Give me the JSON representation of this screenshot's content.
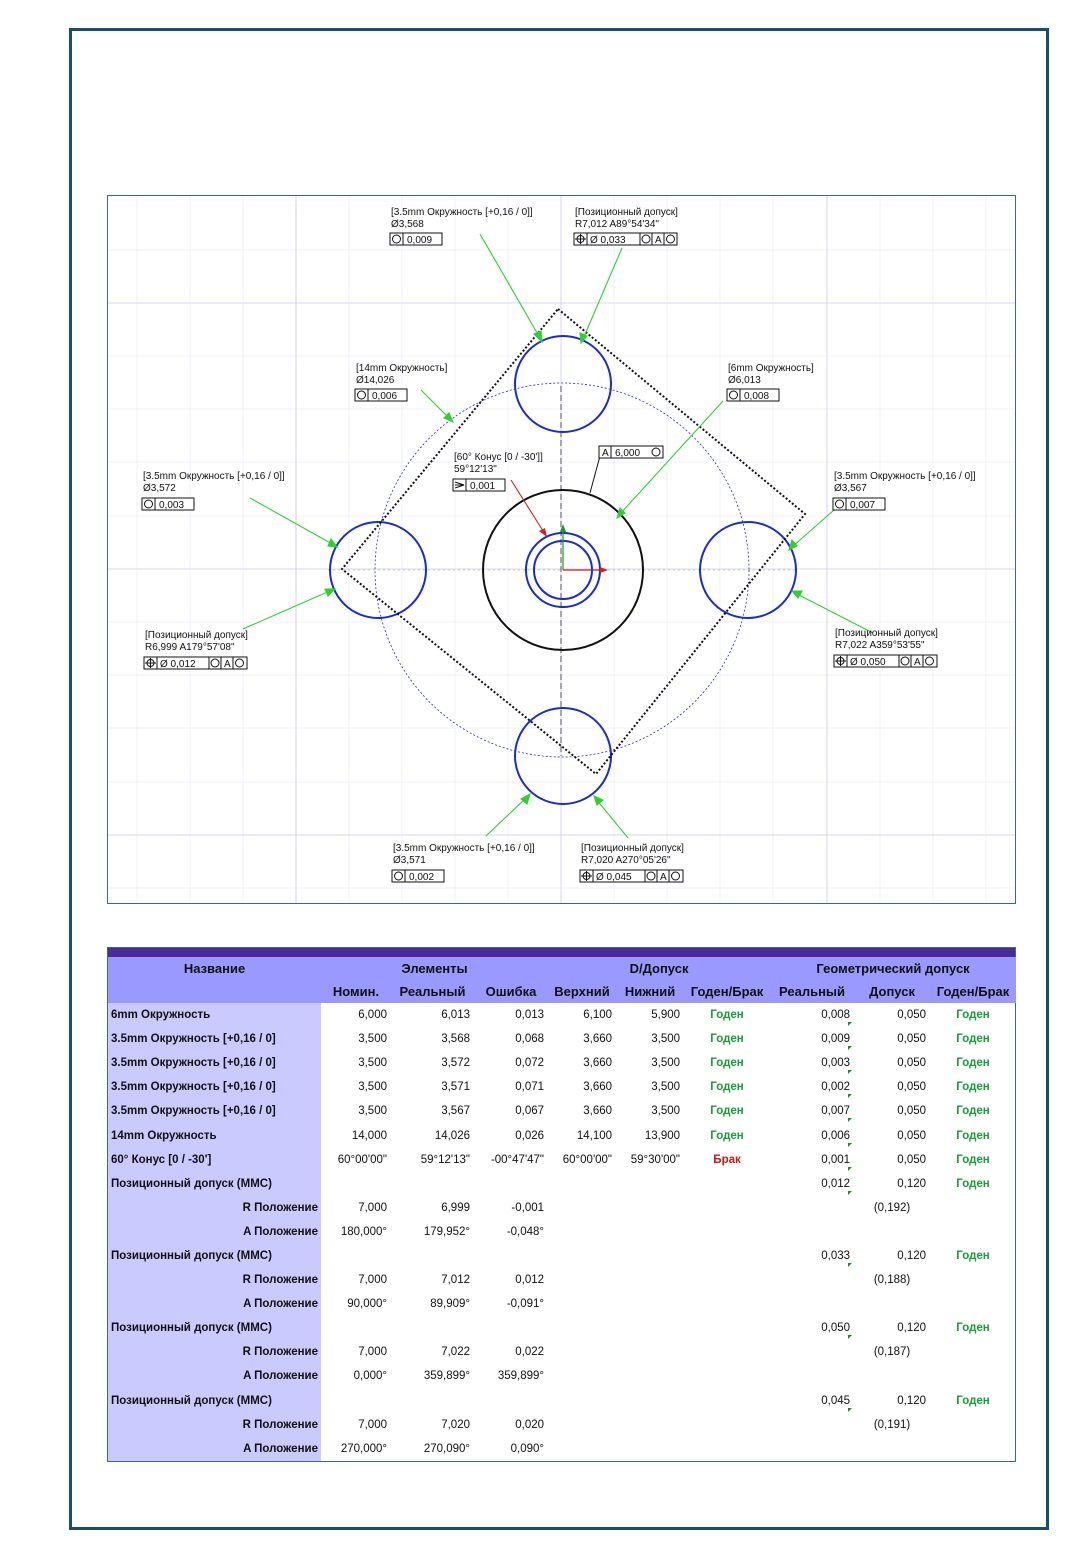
{
  "annotations": {
    "top_circle": {
      "title": "[3.5mm Окружность [+0,16 / 0]]",
      "value": "Ø3,568",
      "tol": "0,009"
    },
    "top_pos": {
      "title": "[Позиционный допуск]",
      "value": "R7,012 A89°54'34\"",
      "tol": "Ø 0,033",
      "ref": "A"
    },
    "c14": {
      "title": "[14mm Окружность]",
      "value": "Ø14,026",
      "tol": "0,006"
    },
    "c6": {
      "title": "[6mm Окружность]",
      "value": "Ø6,013",
      "tol": "0,008"
    },
    "cone": {
      "title": "[60° Конус [0 / -30']]",
      "value": "59°12'13\"",
      "tol": "0,001"
    },
    "datum": {
      "label": "A",
      "value": "6,000"
    },
    "left_circle": {
      "title": "[3.5mm Окружность [+0,16 / 0]]",
      "value": "Ø3,572",
      "tol": "0,003"
    },
    "right_circle": {
      "title": "[3.5mm Окружность [+0,16 / 0]]",
      "value": "Ø3,567",
      "tol": "0,007"
    },
    "left_pos": {
      "title": "[Позиционный допуск]",
      "value": "R6,999 A179°57'08\"",
      "tol": "Ø 0,012",
      "ref": "A"
    },
    "right_pos": {
      "title": "[Позиционный допуск]",
      "value": "R7,022 A359°53'55\"",
      "tol": "Ø 0,050",
      "ref": "A"
    },
    "bottom_circle": {
      "title": "[3.5mm Окружность [+0,16 / 0]]",
      "value": "Ø3,571",
      "tol": "0,002"
    },
    "bottom_pos": {
      "title": "[Позиционный допуск]",
      "value": "R7,020 A270°05'26\"",
      "tol": "Ø 0,045",
      "ref": "A"
    }
  },
  "table": {
    "groups": [
      "Название",
      "Элементы",
      "D/Допуск",
      "Геометрический допуск"
    ],
    "columns": [
      "Номин.",
      "Реальный",
      "Ошибка",
      "Верхний",
      "Нижний",
      "Годен/Брак",
      "Реальный",
      "Допуск",
      "Годен/Брак"
    ],
    "rows": [
      {
        "name": "6mm Окружность",
        "nom": "6,000",
        "real": "6,013",
        "err": "0,013",
        "up": "6,100",
        "low": "5,900",
        "st": "Годен",
        "greal": "0,008",
        "gtol": "0,050",
        "gst": "Годен"
      },
      {
        "name": "3.5mm Окружность [+0,16 / 0]",
        "nom": "3,500",
        "real": "3,568",
        "err": "0,068",
        "up": "3,660",
        "low": "3,500",
        "st": "Годен",
        "greal": "0,009",
        "gtol": "0,050",
        "gst": "Годен"
      },
      {
        "name": "3.5mm Окружность [+0,16 / 0]",
        "nom": "3,500",
        "real": "3,572",
        "err": "0,072",
        "up": "3,660",
        "low": "3,500",
        "st": "Годен",
        "greal": "0,003",
        "gtol": "0,050",
        "gst": "Годен"
      },
      {
        "name": "3.5mm Окружность [+0,16 / 0]",
        "nom": "3,500",
        "real": "3,571",
        "err": "0,071",
        "up": "3,660",
        "low": "3,500",
        "st": "Годен",
        "greal": "0,002",
        "gtol": "0,050",
        "gst": "Годен"
      },
      {
        "name": "3.5mm Окружность [+0,16 / 0]",
        "nom": "3,500",
        "real": "3,567",
        "err": "0,067",
        "up": "3,660",
        "low": "3,500",
        "st": "Годен",
        "greal": "0,007",
        "gtol": "0,050",
        "gst": "Годен"
      },
      {
        "name": "14mm Окружность",
        "nom": "14,000",
        "real": "14,026",
        "err": "0,026",
        "up": "14,100",
        "low": "13,900",
        "st": "Годен",
        "greal": "0,006",
        "gtol": "0,050",
        "gst": "Годен"
      },
      {
        "name": "60° Конус [0 / -30']",
        "nom": "60°00'00\"",
        "real": "59°12'13\"",
        "err": "-00°47'47\"",
        "up": "60°00'00\"",
        "low": "59°30'00\"",
        "st": "Брак",
        "greal": "0,001",
        "gtol": "0,050",
        "gst": "Годен"
      },
      {
        "name": "Позиционный допуск (MMC)",
        "nom": "",
        "real": "",
        "err": "",
        "up": "",
        "low": "",
        "st": "",
        "greal": "0,012",
        "gtol": "0,120",
        "gst": "Годен"
      },
      {
        "name": "R Положение",
        "sub": true,
        "nom": "7,000",
        "real": "6,999",
        "err": "-0,001",
        "up": "",
        "low": "",
        "st": "",
        "greal": "",
        "gtol": "(0,192)",
        "gst": ""
      },
      {
        "name": "A Положение",
        "sub": true,
        "nom": "180,000°",
        "real": "179,952°",
        "err": "-0,048°",
        "up": "",
        "low": "",
        "st": "",
        "greal": "",
        "gtol": "",
        "gst": ""
      },
      {
        "name": "Позиционный допуск (MMC)",
        "nom": "",
        "real": "",
        "err": "",
        "up": "",
        "low": "",
        "st": "",
        "greal": "0,033",
        "gtol": "0,120",
        "gst": "Годен"
      },
      {
        "name": "R Положение",
        "sub": true,
        "nom": "7,000",
        "real": "7,012",
        "err": "0,012",
        "up": "",
        "low": "",
        "st": "",
        "greal": "",
        "gtol": "(0,188)",
        "gst": ""
      },
      {
        "name": "A Положение",
        "sub": true,
        "nom": "90,000°",
        "real": "89,909°",
        "err": "-0,091°",
        "up": "",
        "low": "",
        "st": "",
        "greal": "",
        "gtol": "",
        "gst": ""
      },
      {
        "name": "Позиционный допуск (MMC)",
        "nom": "",
        "real": "",
        "err": "",
        "up": "",
        "low": "",
        "st": "",
        "greal": "0,050",
        "gtol": "0,120",
        "gst": "Годен"
      },
      {
        "name": "R Положение",
        "sub": true,
        "nom": "7,000",
        "real": "7,022",
        "err": "0,022",
        "up": "",
        "low": "",
        "st": "",
        "greal": "",
        "gtol": "(0,187)",
        "gst": ""
      },
      {
        "name": "A Положение",
        "sub": true,
        "nom": "0,000°",
        "real": "359,899°",
        "err": "359,899°",
        "up": "",
        "low": "",
        "st": "",
        "greal": "",
        "gtol": "",
        "gst": ""
      },
      {
        "name": "Позиционный допуск (MMC)",
        "nom": "",
        "real": "",
        "err": "",
        "up": "",
        "low": "",
        "st": "",
        "greal": "0,045",
        "gtol": "0,120",
        "gst": "Годен"
      },
      {
        "name": "R Положение",
        "sub": true,
        "nom": "7,000",
        "real": "7,020",
        "err": "0,020",
        "up": "",
        "low": "",
        "st": "",
        "greal": "",
        "gtol": "(0,191)",
        "gst": ""
      },
      {
        "name": "A Положение",
        "sub": true,
        "nom": "270,000°",
        "real": "270,090°",
        "err": "0,090°",
        "up": "",
        "low": "",
        "st": "",
        "greal": "",
        "gtol": "",
        "gst": ""
      }
    ]
  },
  "colors": {
    "ok": "#1a9a3a",
    "bad": "#c81818",
    "header": "#9999ff",
    "name_col": "#cacaff",
    "feature": "#1a2bd0",
    "leader": "#2fd02f"
  }
}
